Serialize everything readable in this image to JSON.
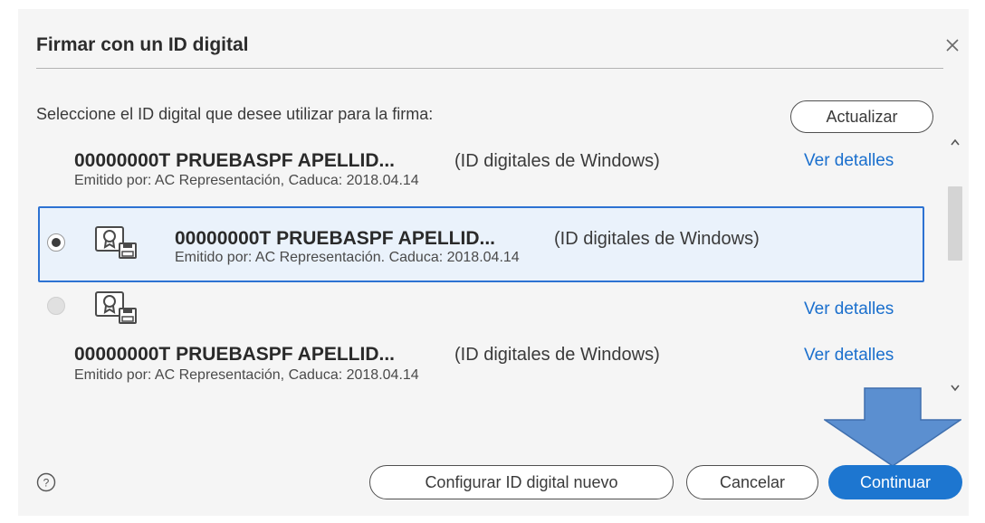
{
  "dialog": {
    "title": "Firmar con un ID digital",
    "close_icon": "close-icon",
    "prompt": "Seleccione el ID digital que desee utilizar para la firma:",
    "refresh_label": "Actualizar"
  },
  "ids": [
    {
      "name": "00000000T PRUEBASPF APELLID...",
      "type": "(ID digitales de Windows)",
      "issuer": "Emitido por: AC Representación, Caduca: 2018.04.14",
      "details_label": "Ver detalles",
      "selected": false
    },
    {
      "name": "00000000T PRUEBASPF APELLID...",
      "type": "(ID digitales de Windows)",
      "issuer": "Emitido por: AC Representación. Caduca: 2018.04.14",
      "details_label": "",
      "selected": true
    },
    {
      "name": "",
      "type": "",
      "issuer": "",
      "details_label": "Ver detalles",
      "selected": false
    },
    {
      "name": "00000000T PRUEBASPF APELLID...",
      "type": "(ID digitales de Windows)",
      "issuer": "Emitido por: AC Representación, Caduca: 2018.04.14",
      "details_label": "Ver detalles",
      "selected": false
    }
  ],
  "footer": {
    "help_icon": "help-icon",
    "configure_label": "Configurar ID digital nuevo",
    "cancel_label": "Cancelar",
    "continue_label": "Continuar"
  },
  "colors": {
    "accent": "#1d76d0",
    "selected_bg": "#eaf2fb",
    "arrow_fill": "#5b8fd0"
  }
}
